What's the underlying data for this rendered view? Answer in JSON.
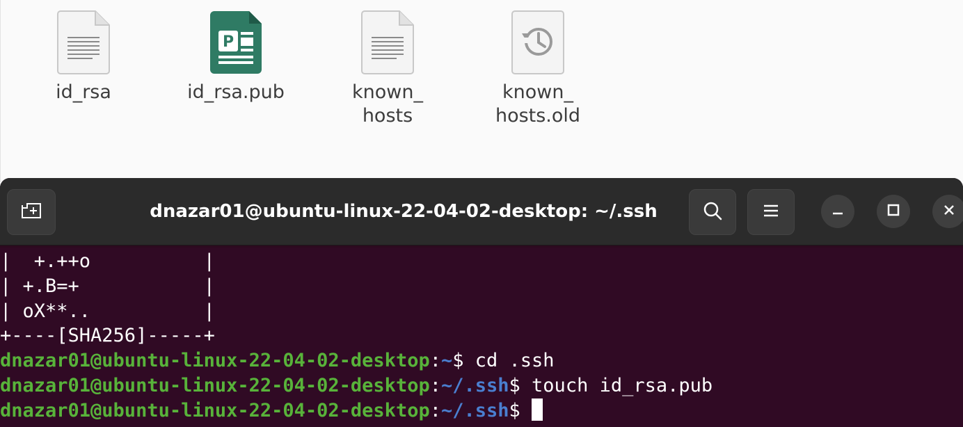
{
  "files": [
    {
      "name": "id_rsa",
      "icon": "text-file-icon"
    },
    {
      "name": "id_rsa.pub",
      "icon": "publisher-file-icon"
    },
    {
      "name": "known_\nhosts",
      "icon": "text-file-icon"
    },
    {
      "name": "known_\nhosts.old",
      "icon": "backup-file-icon"
    }
  ],
  "terminal": {
    "title": "dnazar01@ubuntu-linux-22-04-02-desktop: ~/.ssh",
    "new_tab_icon": "new-tab-icon",
    "search_icon": "search-icon",
    "menu_icon": "hamburger-menu-icon",
    "minimize_icon": "minimize-icon",
    "maximize_icon": "maximize-icon",
    "close_icon": "close-icon",
    "art_lines": [
      "|  +.++o          |",
      "| +.B=+           |",
      "| oX**..          |",
      "+----[SHA256]-----+"
    ],
    "prompt_lines": [
      {
        "user": "dnazar01@ubuntu-linux-22-04-02-desktop",
        "sep": ":",
        "path": "~",
        "dollar": "$ ",
        "command": "cd .ssh"
      },
      {
        "user": "dnazar01@ubuntu-linux-22-04-02-desktop",
        "sep": ":",
        "path": "~/.ssh",
        "dollar": "$ ",
        "command": "touch id_rsa.pub"
      },
      {
        "user": "dnazar01@ubuntu-linux-22-04-02-desktop",
        "sep": ":",
        "path": "~/.ssh",
        "dollar": "$ ",
        "command": ""
      }
    ]
  },
  "colors": {
    "terminal_bg": "#300a24",
    "titlebar_bg": "#2b2b2b",
    "prompt_user": "#58b33a",
    "prompt_path": "#4a7fd0",
    "publisher_green": "#2f7b64"
  }
}
